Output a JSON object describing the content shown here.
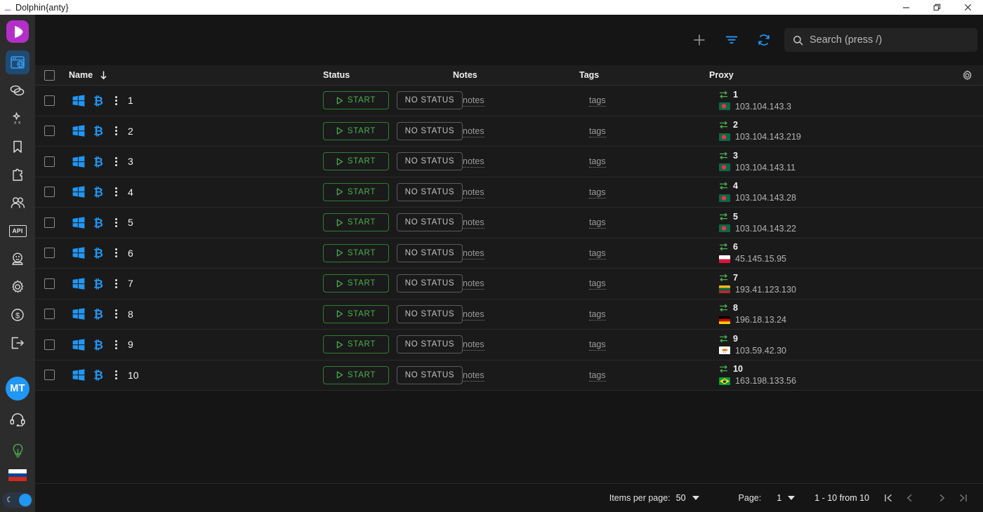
{
  "window": {
    "title": "Dolphin{anty}",
    "dot_icon": "dolphin-dot",
    "minimize_label": "Minimize",
    "restore_label": "Restore",
    "close_label": "Close"
  },
  "sidebar": {
    "logo_label": "Dolphin Anty",
    "items": [
      {
        "icon": "browser-profiles-icon",
        "label": "Browser profiles",
        "active": true
      },
      {
        "icon": "link-chain-icon",
        "label": "Quick links",
        "active": false
      },
      {
        "icon": "magic-clean-icon",
        "label": "Cookie robot",
        "active": false
      },
      {
        "icon": "bookmark-icon",
        "label": "Bookmarks",
        "active": false
      },
      {
        "icon": "puzzle-extension-icon",
        "label": "Extensions",
        "active": false
      },
      {
        "icon": "team-members-icon",
        "label": "Team",
        "active": false
      },
      {
        "icon": "api-icon",
        "label": "API",
        "active": false
      },
      {
        "icon": "crystal-ball-icon",
        "label": "Automation",
        "active": false
      },
      {
        "icon": "gear-settings-icon",
        "label": "Settings",
        "active": false
      },
      {
        "icon": "dollar-coin-icon",
        "label": "Billing",
        "active": false
      },
      {
        "icon": "logout-icon",
        "label": "Logout",
        "active": false
      }
    ],
    "avatar": {
      "initials": "MT",
      "color": "#2196f3"
    },
    "bottom_items": [
      {
        "icon": "headset-support-icon",
        "label": "Support"
      },
      {
        "icon": "lightbulb-idea-icon",
        "label": "Tips",
        "color": "#4caf50"
      }
    ],
    "language": {
      "icon": "flag-ru-icon",
      "label": "Russian"
    },
    "theme_toggle": {
      "icon": "moon-icon",
      "label": "Dark mode",
      "on": true
    }
  },
  "toolbar": {
    "add_label": "Add profile",
    "add_icon": "plus-icon",
    "filter_label": "Filter",
    "filter_icon": "filter-icon",
    "refresh_label": "Refresh",
    "refresh_icon": "refresh-icon",
    "search": {
      "icon": "search-icon",
      "placeholder": "Search (press /)",
      "value": ""
    }
  },
  "table": {
    "select_all_label": "Select all",
    "settings_icon": "gear-icon",
    "columns": [
      {
        "key": "name",
        "label": "Name",
        "sort_icon": "arrow-down-icon"
      },
      {
        "key": "status",
        "label": "Status"
      },
      {
        "key": "notes",
        "label": "Notes"
      },
      {
        "key": "tags",
        "label": "Tags"
      },
      {
        "key": "proxy",
        "label": "Proxy"
      }
    ],
    "row_defaults": {
      "os_icon": "windows-icon",
      "crypto_icon": "bitcoin-icon",
      "menu_icon": "kebab-menu-icon",
      "start_label": "START",
      "start_icon": "play-icon",
      "status_label": "NO STATUS",
      "notes_label": "notes",
      "tags_label": "tags",
      "proxy_icon": "proxy-swap-icon"
    },
    "rows": [
      {
        "name": "1",
        "proxy_num": "1",
        "proxy_ip": "103.104.143.3",
        "flag": "bd"
      },
      {
        "name": "2",
        "proxy_num": "2",
        "proxy_ip": "103.104.143.219",
        "flag": "bd"
      },
      {
        "name": "3",
        "proxy_num": "3",
        "proxy_ip": "103.104.143.11",
        "flag": "bd"
      },
      {
        "name": "4",
        "proxy_num": "4",
        "proxy_ip": "103.104.143.28",
        "flag": "bd"
      },
      {
        "name": "5",
        "proxy_num": "5",
        "proxy_ip": "103.104.143.22",
        "flag": "bd"
      },
      {
        "name": "6",
        "proxy_num": "6",
        "proxy_ip": "45.145.15.95",
        "flag": "pl"
      },
      {
        "name": "7",
        "proxy_num": "7",
        "proxy_ip": "193.41.123.130",
        "flag": "lt"
      },
      {
        "name": "8",
        "proxy_num": "8",
        "proxy_ip": "196.18.13.24",
        "flag": "de"
      },
      {
        "name": "9",
        "proxy_num": "9",
        "proxy_ip": "103.59.42.30",
        "flag": "cy"
      },
      {
        "name": "10",
        "proxy_num": "10",
        "proxy_ip": "163.198.133.56",
        "flag": "br"
      }
    ]
  },
  "footer": {
    "items_per_page_label": "Items per page:",
    "items_per_page_value": "50",
    "page_label": "Page:",
    "page_value": "1",
    "range_text": "1 - 10 from 10",
    "first_label": "First page",
    "prev_label": "Previous page",
    "next_label": "Next page",
    "last_label": "Last page"
  },
  "colors": {
    "accent_purple": "#b42ec8",
    "accent_blue": "#2196f3",
    "start_green": "#4caf50",
    "background": "#151515"
  }
}
